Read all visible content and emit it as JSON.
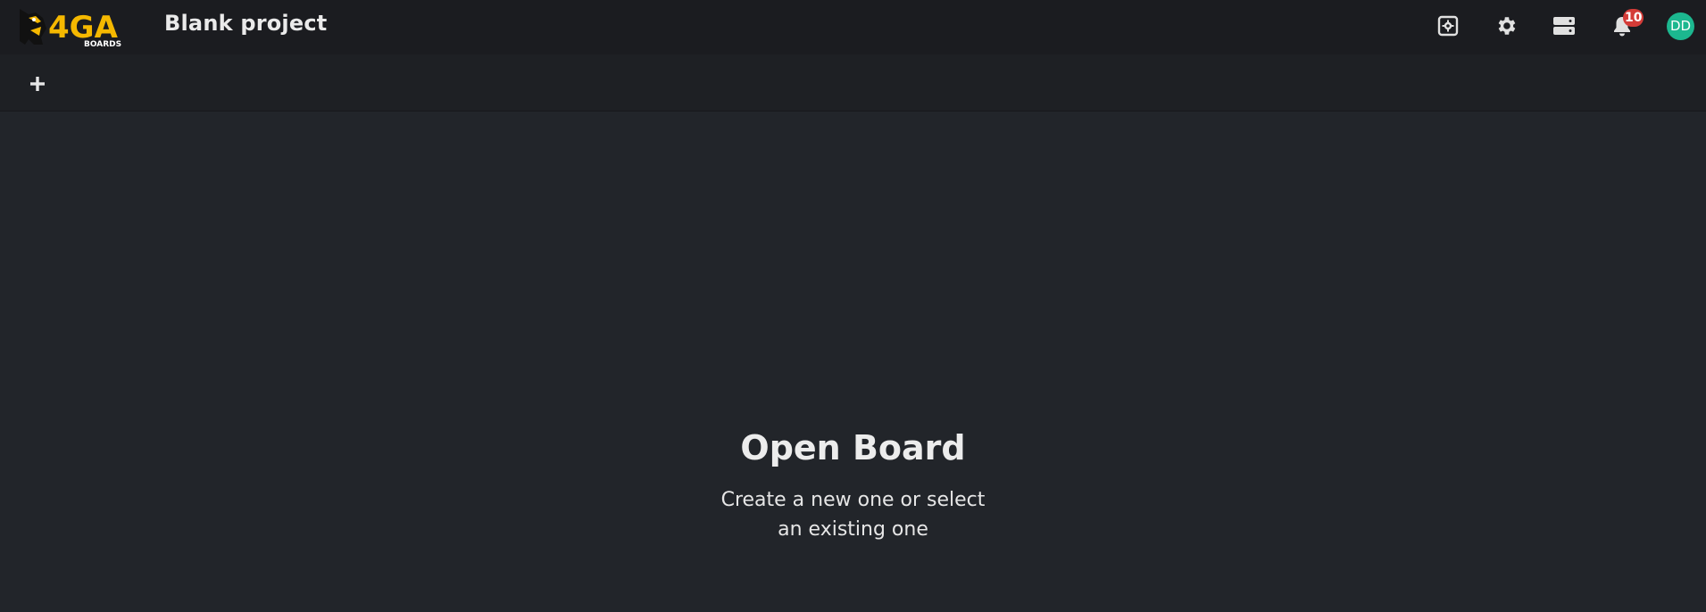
{
  "header": {
    "logo_text": "4GA",
    "logo_subtext": "BOARDS",
    "project_title": "Blank project",
    "icons": [
      "settings-square-icon",
      "gear-icon",
      "server-icon",
      "bell-icon"
    ],
    "notification_count": "10",
    "avatar_initials": "DD",
    "avatar_color": "#1cb78f",
    "logo_color": "#f5b800"
  },
  "toolbar": {
    "add_icon": "plus-icon"
  },
  "main": {
    "title": "Open Board",
    "description": "Create a new one or select an existing one"
  }
}
